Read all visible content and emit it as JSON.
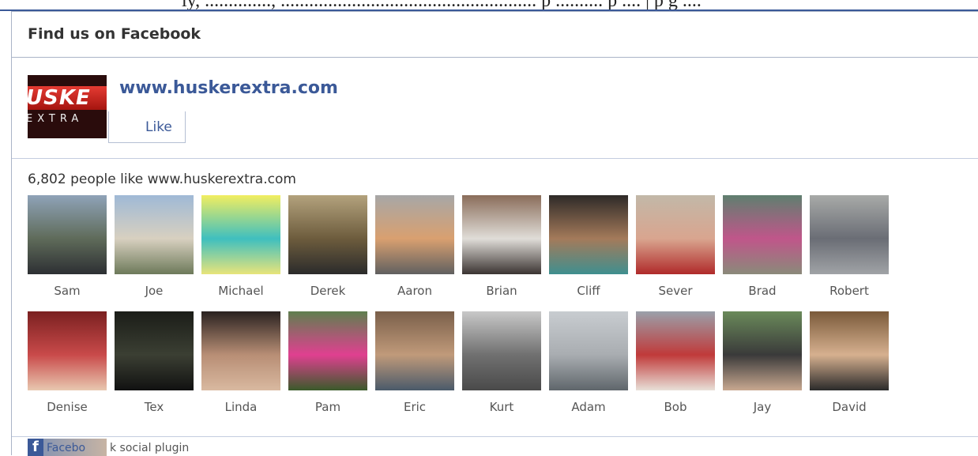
{
  "top_strip": {
    "text": "ly, .............., ...................................................... p .......... p .... | p g ...."
  },
  "widget": {
    "title": "Find us on Facebook",
    "page_name": "www.huskerextra.com",
    "logo_text_1": "USKE",
    "logo_text_2": "EXTRA",
    "like_label": "Like",
    "likes_count_text": "6,802 people like www.huskerextra.com",
    "footer_text_part1": "Facebo",
    "footer_text_part2": "k social plugin",
    "colors": {
      "link": "#3b5998",
      "border": "#aab4c8"
    }
  },
  "fans": [
    {
      "name": "Sam",
      "colors": [
        "#8fa3b8",
        "#5f6b5a",
        "#2d2f33"
      ]
    },
    {
      "name": "Joe",
      "colors": [
        "#9fb9d6",
        "#d8d0c0",
        "#6d7a5a"
      ]
    },
    {
      "name": "Michael",
      "colors": [
        "#f2ee60",
        "#3fbfbf",
        "#e8e47a"
      ]
    },
    {
      "name": "Derek",
      "colors": [
        "#b3a27d",
        "#6d5c3d",
        "#2b2b2b"
      ]
    },
    {
      "name": "Aaron",
      "colors": [
        "#a7a7a7",
        "#d9a070",
        "#606060"
      ]
    },
    {
      "name": "Brian",
      "colors": [
        "#8a6d5a",
        "#e0ddd8",
        "#3b3432"
      ]
    },
    {
      "name": "Cliff",
      "colors": [
        "#2e2a28",
        "#a47a5a",
        "#3f8f8f"
      ]
    },
    {
      "name": "Sever",
      "colors": [
        "#c2b8a8",
        "#d9a58f",
        "#b02a2a"
      ]
    },
    {
      "name": "Brad",
      "colors": [
        "#5f7f6f",
        "#c0568a",
        "#8a8a7a"
      ]
    },
    {
      "name": "Robert",
      "colors": [
        "#a8aaa8",
        "#6a6d75",
        "#a0a3a6"
      ]
    },
    {
      "name": "Denise",
      "colors": [
        "#7a2020",
        "#c94a4a",
        "#e8c8b0"
      ]
    },
    {
      "name": "Tex",
      "colors": [
        "#1b1d18",
        "#3b3f33",
        "#111"
      ]
    },
    {
      "name": "Linda",
      "colors": [
        "#2a2220",
        "#b88e75",
        "#d9b9a0"
      ]
    },
    {
      "name": "Pam",
      "colors": [
        "#5f7f4f",
        "#e04090",
        "#3a5a2a"
      ]
    },
    {
      "name": "Eric",
      "colors": [
        "#7a5f4a",
        "#c09a7a",
        "#4a5a6a"
      ]
    },
    {
      "name": "Kurt",
      "colors": [
        "#c8c8c8",
        "#707070",
        "#4a4a4a"
      ]
    },
    {
      "name": "Adam",
      "colors": [
        "#c8ccd0",
        "#a9adb1",
        "#5f666b"
      ]
    },
    {
      "name": "Bob",
      "colors": [
        "#9aa0aa",
        "#c03a3a",
        "#e8e0d8"
      ]
    },
    {
      "name": "Jay",
      "colors": [
        "#6a8a5a",
        "#3a3a3a",
        "#c8a890"
      ]
    },
    {
      "name": "David",
      "colors": [
        "#7a5a3a",
        "#d6b08f",
        "#2a2a2a"
      ]
    }
  ]
}
